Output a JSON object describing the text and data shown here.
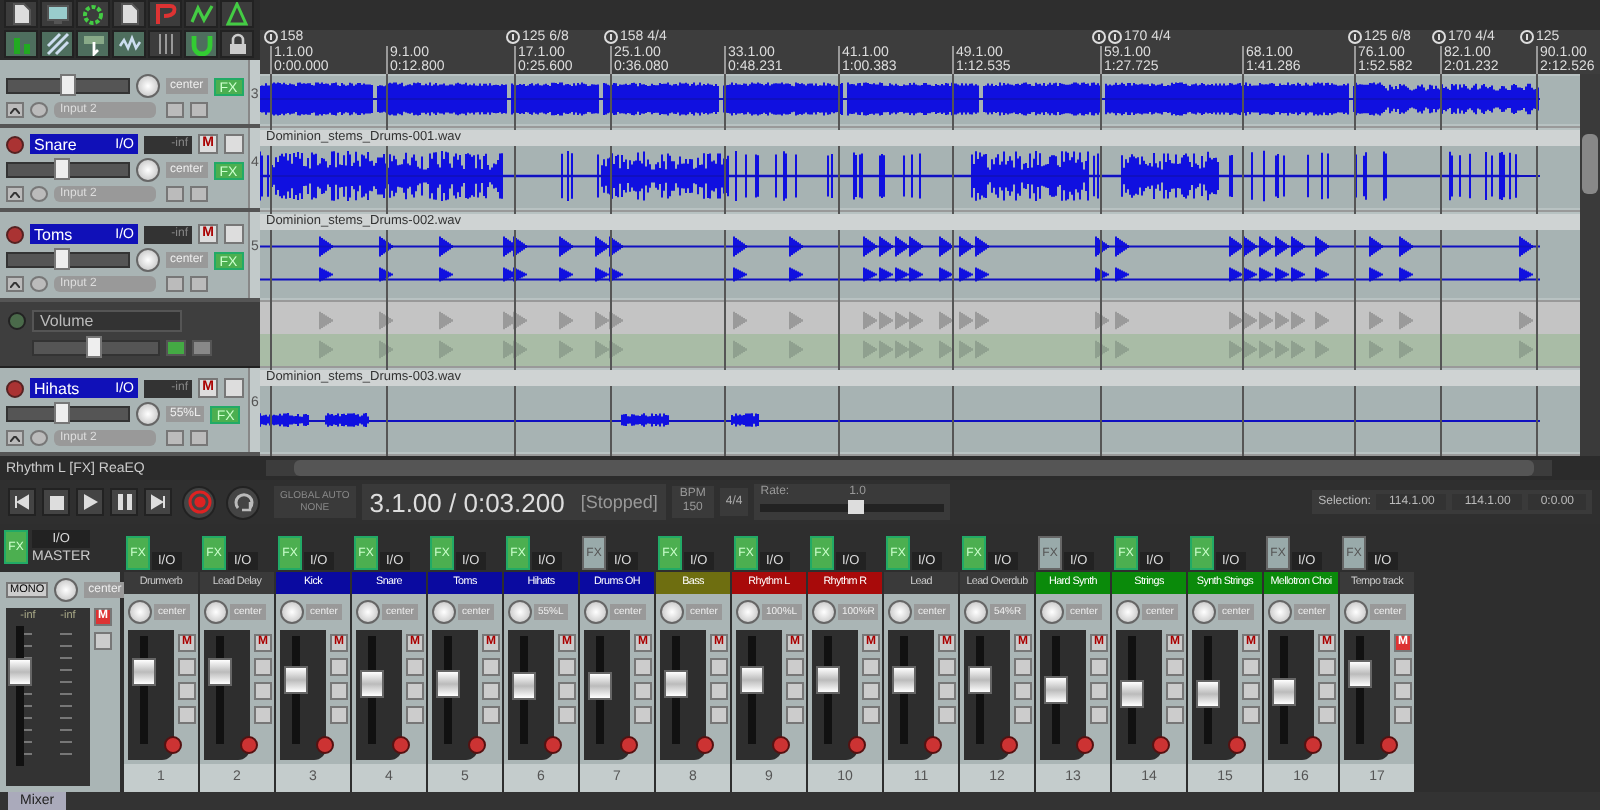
{
  "toolbar": [
    {
      "kind": "page",
      "on": false
    },
    {
      "kind": "screen",
      "on": false
    },
    {
      "kind": "gear",
      "on": false
    },
    {
      "kind": "page",
      "on": false
    },
    {
      "kind": "curve",
      "on": false
    },
    {
      "kind": "zigzag",
      "on": false
    },
    {
      "kind": "triangle",
      "on": false
    },
    {
      "kind": "bars",
      "on": true
    },
    {
      "kind": "diagonal",
      "on": true
    },
    {
      "kind": "pointer",
      "on": true
    },
    {
      "kind": "wave",
      "on": true
    },
    {
      "kind": "grid",
      "on": false
    },
    {
      "kind": "magnet",
      "on": true
    },
    {
      "kind": "lock",
      "on": false
    }
  ],
  "tracks": [
    {
      "kind": "partial",
      "number": "3",
      "pan": "center",
      "fx": "FX",
      "input": "Input 2",
      "level": 0.5
    },
    {
      "kind": "track",
      "number": "4",
      "name": "Snare",
      "io": "I/O",
      "meter": "-inf",
      "mute": "M",
      "pan": "center",
      "fx": "FX",
      "input": "Input 2",
      "level": 0.45
    },
    {
      "kind": "track",
      "number": "5",
      "name": "Toms",
      "io": "I/O",
      "meter": "-inf",
      "mute": "M",
      "pan": "center",
      "fx": "FX",
      "input": "Input 2",
      "level": 0.45
    },
    {
      "kind": "envelope",
      "name": "Volume",
      "level": 0.5
    },
    {
      "kind": "track",
      "number": "6",
      "name": "Hihats",
      "io": "I/O",
      "meter": "-inf",
      "mute": "M",
      "pan": "55%L",
      "fx": "FX",
      "input": "Input 2",
      "level": 0.45
    }
  ],
  "ruler": {
    "markers": [
      {
        "kind": "tempo",
        "label": "158"
      },
      {
        "kind": "tempo",
        "label": "125 6/8"
      },
      {
        "kind": "tempo",
        "label": "158 4/4"
      },
      {
        "kind": "plain"
      },
      {
        "kind": "tempo",
        "label": "170 4/4"
      },
      {
        "kind": "tempo",
        "label": "125 6/8"
      },
      {
        "kind": "tempo",
        "label": "170 4/4"
      },
      {
        "kind": "tempo",
        "label": "125"
      }
    ],
    "ticks": [
      {
        "bar": "1.1.00",
        "time": "0:00.000"
      },
      {
        "bar": "9.1.00",
        "time": "0:12.800"
      },
      {
        "bar": "17.1.00",
        "time": "0:25.600"
      },
      {
        "bar": "25.1.00",
        "time": "0:36.080"
      },
      {
        "bar": "33.1.00",
        "time": "0:48.231"
      },
      {
        "bar": "41.1.00",
        "time": "1:00.383"
      },
      {
        "bar": "49.1.00",
        "time": "1:12.535"
      },
      {
        "bar": "59.1.00",
        "time": "1:27.725"
      },
      {
        "bar": "68.1.00",
        "time": "1:41.286"
      },
      {
        "bar": "76.1.00",
        "time": "1:52.582"
      },
      {
        "bar": "82.1.00",
        "time": "2:01.232"
      },
      {
        "bar": "90.1.00",
        "time": "2:12.526"
      }
    ]
  },
  "lanes": [
    {
      "kind": "dense"
    },
    {
      "kind": "drums",
      "file": "Dominion_stems_Drums-001.wav"
    },
    {
      "kind": "hits",
      "file": "Dominion_stems_Drums-002.wav"
    },
    {
      "kind": "envelope"
    },
    {
      "kind": "sparse",
      "file": "Dominion_stems_Drums-003.wav"
    }
  ],
  "transport": {
    "fx_chain": "Rhythm L [FX] ReaEQ",
    "buttons": [
      {
        "kind": "skip-back"
      },
      {
        "kind": "stop"
      },
      {
        "kind": "play"
      },
      {
        "kind": "pause"
      },
      {
        "kind": "skip-forward"
      },
      {
        "kind": "record"
      },
      {
        "kind": "repeat"
      }
    ],
    "global_auto": {
      "label": "GLOBAL AUTO",
      "value": "NONE"
    },
    "position": "3.1.00 / 0:03.200",
    "state": "[Stopped]",
    "bpm": {
      "label": "BPM",
      "value": "150"
    },
    "time_sig": "4/4",
    "rate": {
      "label": "Rate:",
      "value": "1.0",
      "level": 0.5
    },
    "selection": {
      "label": "Selection:",
      "start": "114.1.00",
      "end": "114.1.00",
      "length": "0:0.00"
    }
  },
  "mixer": {
    "master": {
      "fx": "FX",
      "io": "I/O",
      "name": "MASTER",
      "mono": "MONO",
      "pan": "center",
      "mute": "M",
      "meter_left": "-inf",
      "meter_right": "-inf",
      "level": 0.72
    },
    "strips": [
      {
        "name": "Drumverb",
        "fx": "FX",
        "fx_on": true,
        "io": "I/O",
        "pan": "center",
        "mute": "M",
        "muted": false,
        "level": 0.72,
        "number": "1"
      },
      {
        "name": "Lead Delay",
        "fx": "FX",
        "fx_on": true,
        "io": "I/O",
        "pan": "center",
        "mute": "M",
        "muted": false,
        "level": 0.72,
        "number": "2"
      },
      {
        "name": "Kick",
        "color": "#0a0aa0",
        "fx": "FX",
        "fx_on": true,
        "io": "I/O",
        "pan": "center",
        "mute": "M",
        "muted": false,
        "level": 0.62,
        "number": "3"
      },
      {
        "name": "Snare",
        "color": "#0a0aa0",
        "fx": "FX",
        "fx_on": true,
        "io": "I/O",
        "pan": "center",
        "mute": "M",
        "muted": false,
        "level": 0.58,
        "number": "4"
      },
      {
        "name": "Toms",
        "color": "#0a0aa0",
        "fx": "FX",
        "fx_on": true,
        "io": "I/O",
        "pan": "center",
        "mute": "M",
        "muted": false,
        "level": 0.58,
        "number": "5"
      },
      {
        "name": "Hihats",
        "color": "#0a0aa0",
        "fx": "FX",
        "fx_on": true,
        "io": "I/O",
        "pan": "55%L",
        "mute": "M",
        "muted": false,
        "level": 0.55,
        "number": "6"
      },
      {
        "name": "Drums OH",
        "color": "#0a0aa0",
        "fx": "FX",
        "fx_on": false,
        "io": "I/O",
        "pan": "center",
        "mute": "M",
        "muted": false,
        "level": 0.55,
        "number": "7"
      },
      {
        "name": "Bass",
        "color": "#6e6e10",
        "fx": "FX",
        "fx_on": true,
        "io": "I/O",
        "pan": "center",
        "mute": "M",
        "muted": false,
        "level": 0.58,
        "number": "8"
      },
      {
        "name": "Rhythm L",
        "color": "#a80a0a",
        "fx": "FX",
        "fx_on": true,
        "io": "I/O",
        "pan": "100%L",
        "mute": "M",
        "muted": false,
        "level": 0.62,
        "number": "9"
      },
      {
        "name": "Rhythm R",
        "color": "#a80a0a",
        "fx": "FX",
        "fx_on": true,
        "io": "I/O",
        "pan": "100%R",
        "mute": "M",
        "muted": false,
        "level": 0.62,
        "number": "10"
      },
      {
        "name": "Lead",
        "fx": "FX",
        "fx_on": true,
        "io": "I/O",
        "pan": "center",
        "mute": "M",
        "muted": false,
        "level": 0.62,
        "number": "11"
      },
      {
        "name": "Lead Overdub",
        "fx": "FX",
        "fx_on": true,
        "io": "I/O",
        "pan": "54%R",
        "mute": "M",
        "muted": false,
        "level": 0.62,
        "number": "12"
      },
      {
        "name": "Hard Synth",
        "color": "#0a8a0a",
        "fx": "FX",
        "fx_on": false,
        "io": "I/O",
        "pan": "center",
        "mute": "M",
        "muted": false,
        "level": 0.5,
        "number": "13"
      },
      {
        "name": "Strings",
        "color": "#0a8a0a",
        "fx": "FX",
        "fx_on": true,
        "io": "I/O",
        "pan": "center",
        "mute": "M",
        "muted": false,
        "level": 0.45,
        "number": "14"
      },
      {
        "name": "Synth Strings",
        "color": "#0a8a0a",
        "fx": "FX",
        "fx_on": true,
        "io": "I/O",
        "pan": "center",
        "mute": "M",
        "muted": false,
        "level": 0.45,
        "number": "15"
      },
      {
        "name": "Mellotron Choi",
        "color": "#0a8a0a",
        "fx": "FX",
        "fx_on": false,
        "io": "I/O",
        "pan": "center",
        "mute": "M",
        "muted": false,
        "level": 0.48,
        "number": "16"
      },
      {
        "name": "Tempo track",
        "fx": "FX",
        "fx_on": false,
        "io": "I/O",
        "pan": "center",
        "mute": "M",
        "muted": true,
        "level": 0.7,
        "number": "17"
      }
    ]
  },
  "tab": {
    "label": "Mixer"
  }
}
